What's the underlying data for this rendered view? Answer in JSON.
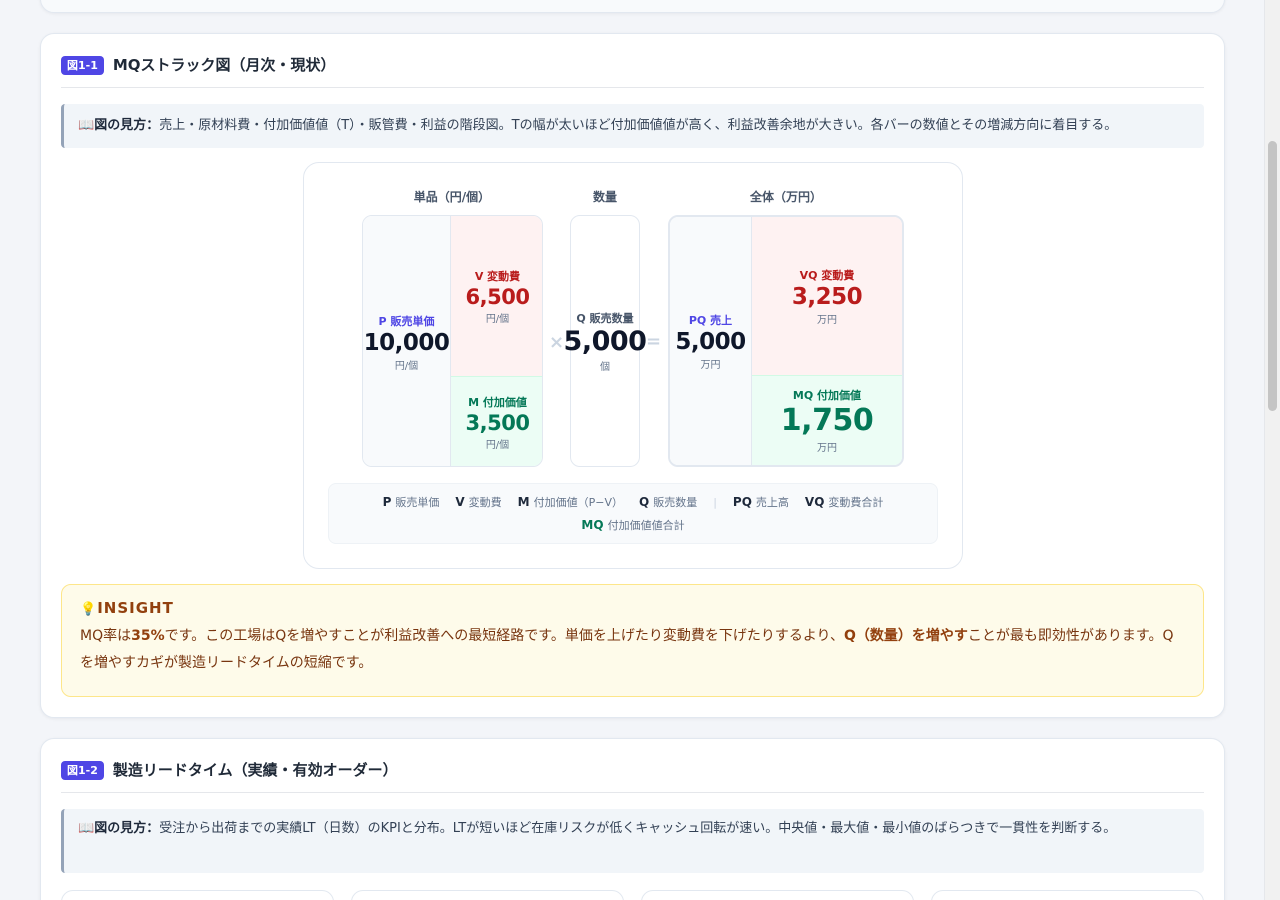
{
  "fig1": {
    "badge": "図1-1",
    "title": "MQストラック図（月次・現状）",
    "howto_label": "図の見方：",
    "howto_text": "売上・原材料費・付加価値値（T）・販管費・利益の階段図。Tの幅が太いほど付加価値値が高く、利益改善余地が大きい。各バーの数値とその増減方向に着目する。",
    "col_unit": "単品（円/個）",
    "col_qty": "数量",
    "col_total": "全体（万円）",
    "p": {
      "label": "P 販売単価",
      "value": "10,000",
      "unit": "円/個"
    },
    "v": {
      "label": "V 変動費",
      "value": "6,500",
      "unit": "円/個"
    },
    "m": {
      "label": "M 付加価値",
      "value": "3,500",
      "unit": "円/個"
    },
    "times": "×",
    "q": {
      "label": "Q 販売数量",
      "value": "5,000",
      "unit": "個"
    },
    "equals": "=",
    "pq": {
      "label": "PQ 売上",
      "value": "5,000",
      "unit": "万円"
    },
    "vq": {
      "label": "VQ 変動費",
      "value": "3,250",
      "unit": "万円"
    },
    "mq": {
      "label": "MQ 付加価値",
      "value": "1,750",
      "unit": "万円"
    },
    "legend": {
      "p_key": "P",
      "p_desc": "販売単価",
      "v_key": "V",
      "v_desc": "変動費",
      "m_key": "M",
      "m_desc": "付加価値（P−V）",
      "q_key": "Q",
      "q_desc": "販売数量",
      "sep": "|",
      "pq_key": "PQ",
      "pq_desc": "売上高",
      "vq_key": "VQ",
      "vq_desc": "変動費合計",
      "mq_key": "MQ",
      "mq_desc": "付加価値値合計"
    },
    "insight": {
      "title": "INSIGHT",
      "t1": "MQ率は",
      "b1": "35%",
      "t2": "です。この工場はQを増やすことが利益改善への最短経路です。単価を上げたり変動費を下げたりするより、",
      "b2": "Q（数量）を増やす",
      "t3": "ことが最も即効性があります。Qを増やすカギが製造リードタイムの短縮です。"
    }
  },
  "fig2": {
    "badge": "図1-2",
    "title": "製造リードタイム（実績・有効オーダー）",
    "howto_label": "図の見方：",
    "howto_text": "受注から出荷までの実績LT（日数）のKPIと分布。LTが短いほど在庫リスクが低くキャッシュ回転が速い。中央値・最大値・最小値のばらつきで一貫性を判断する。"
  },
  "colors": {
    "accent": "#4f46e5",
    "red": "#b91c1c",
    "green": "#047857",
    "insight_bg": "#fefbea"
  }
}
